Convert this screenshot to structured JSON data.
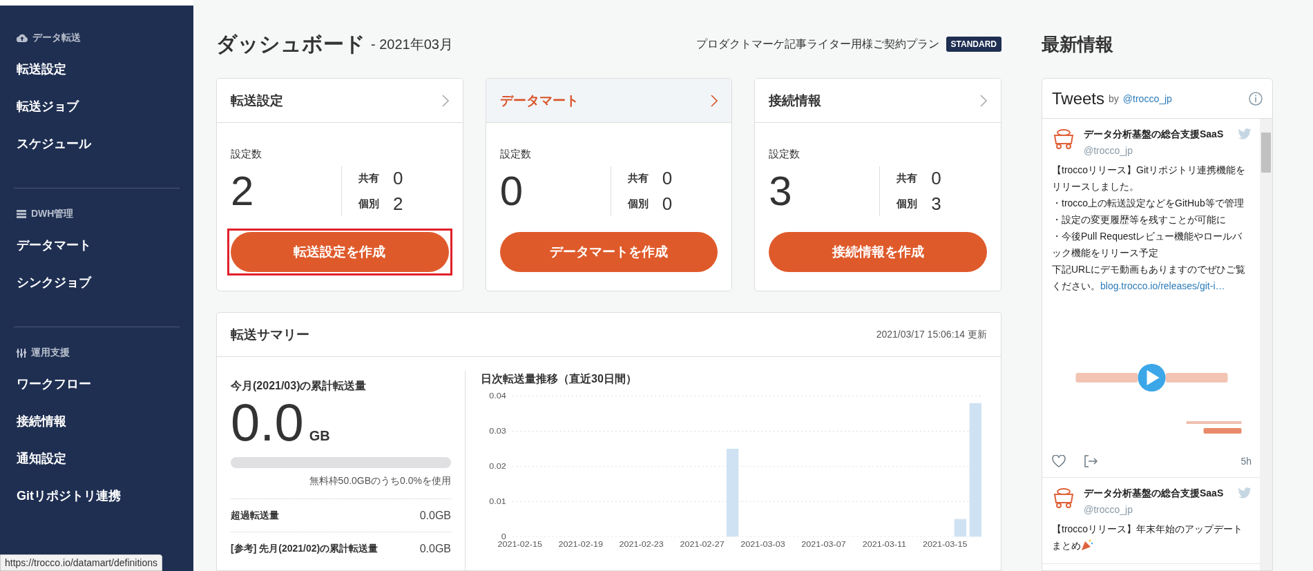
{
  "sidebar": {
    "sections": [
      {
        "kind": "upload",
        "heading": "データ転送",
        "items": [
          {
            "label": "転送設定",
            "selected": false
          },
          {
            "label": "転送ジョブ",
            "selected": false
          },
          {
            "label": "スケジュール",
            "selected": false
          }
        ]
      },
      {
        "kind": "list",
        "heading": "DWH管理",
        "items": [
          {
            "label": "データマート",
            "selected": false
          },
          {
            "label": "シンクジョブ",
            "selected": false
          }
        ]
      },
      {
        "kind": "sliders",
        "heading": "運用支援",
        "items": [
          {
            "label": "ワークフロー",
            "selected": false
          },
          {
            "label": "接続情報",
            "selected": false
          },
          {
            "label": "通知設定",
            "selected": false
          },
          {
            "label": "Gitリポジトリ連携",
            "selected": false
          }
        ]
      }
    ]
  },
  "status_url": "https://trocco.io/datamart/definitions",
  "header": {
    "title": "ダッシュボード",
    "period": "- 2021年03月",
    "plan": "プロダクトマーケ記事ライター用様ご契約プラン",
    "plan_badge": "STANDARD"
  },
  "cards": [
    {
      "title": "転送設定",
      "highlighted": false,
      "count_label": "設定数",
      "count": "2",
      "shared_label": "共有",
      "shared": "0",
      "individual_label": "個別",
      "individual": "2",
      "button": "転送設定を作成",
      "outlined": true
    },
    {
      "title": "データマート",
      "highlighted": true,
      "count_label": "設定数",
      "count": "0",
      "shared_label": "共有",
      "shared": "0",
      "individual_label": "個別",
      "individual": "0",
      "button": "データマートを作成",
      "outlined": false
    },
    {
      "title": "接続情報",
      "highlighted": false,
      "count_label": "設定数",
      "count": "3",
      "shared_label": "共有",
      "shared": "0",
      "individual_label": "個別",
      "individual": "3",
      "button": "接続情報を作成",
      "outlined": false
    }
  ],
  "summary": {
    "title": "転送サマリー",
    "updated": "2021/03/17 15:06:14 更新",
    "month_label": "今月(2021/03)の累計転送量",
    "amount": "0.0",
    "unit": "GB",
    "usage": {
      "level": 0
    },
    "usage_text": "無料枠50.0GBのうち0.0%を使用",
    "rows": [
      {
        "label": "超過転送量",
        "value": "0.0GB"
      },
      {
        "label": "[参考] 先月(2021/02)の累計転送量",
        "value": "0.0GB"
      }
    ],
    "chart_title": "日次転送量推移（直近30日間）",
    "chart_data": {
      "type": "bar",
      "grid": true,
      "categories": [
        "2021-02-15",
        null,
        null,
        null,
        "2021-02-19",
        null,
        null,
        null,
        "2021-02-23",
        null,
        null,
        null,
        "2021-02-27",
        null,
        null,
        null,
        "2021-03-03",
        null,
        null,
        null,
        "2021-03-07",
        null,
        null,
        null,
        "2021-03-11",
        null,
        null,
        null,
        "2021-03-15",
        null,
        null
      ],
      "values": [
        0,
        0,
        0,
        0,
        0,
        0,
        0,
        0,
        0,
        0,
        0,
        0,
        0,
        0,
        0.025,
        0,
        0,
        0,
        0,
        0,
        0,
        0,
        0,
        0,
        0,
        0,
        0,
        0,
        0,
        0.005,
        0.038
      ],
      "ylim": [
        0,
        0.04
      ],
      "yticks": [
        0,
        0.01,
        0.02,
        0.03,
        0.04
      ]
    }
  },
  "news": {
    "title": "最新情報",
    "widget": {
      "title": "Tweets",
      "by": "by",
      "account": "@trocco_jp"
    },
    "tweets": [
      {
        "name": "データ分析基盤の総合支援SaaS",
        "handle": "@trocco_jp",
        "lines": [
          "【troccoリリース】Gitリポジトリ連携機能をリリースしました。",
          "・trocco上の転送設定などをGitHub等で管理",
          "・設定の変更履歴等を残すことが可能に",
          "・今後Pull Requestレビュー機能やロールバック機能をリリース予定",
          "下記URLにデモ動画もありますのでぜひご覧ください。"
        ],
        "link": "blog.trocco.io/releases/git-i…",
        "time": "5h"
      },
      {
        "name": "データ分析基盤の総合支援SaaS",
        "handle": "@trocco_jp",
        "lines": [
          "【troccoリリース】年末年始のアップデートまとめ"
        ],
        "party": true
      }
    ]
  }
}
